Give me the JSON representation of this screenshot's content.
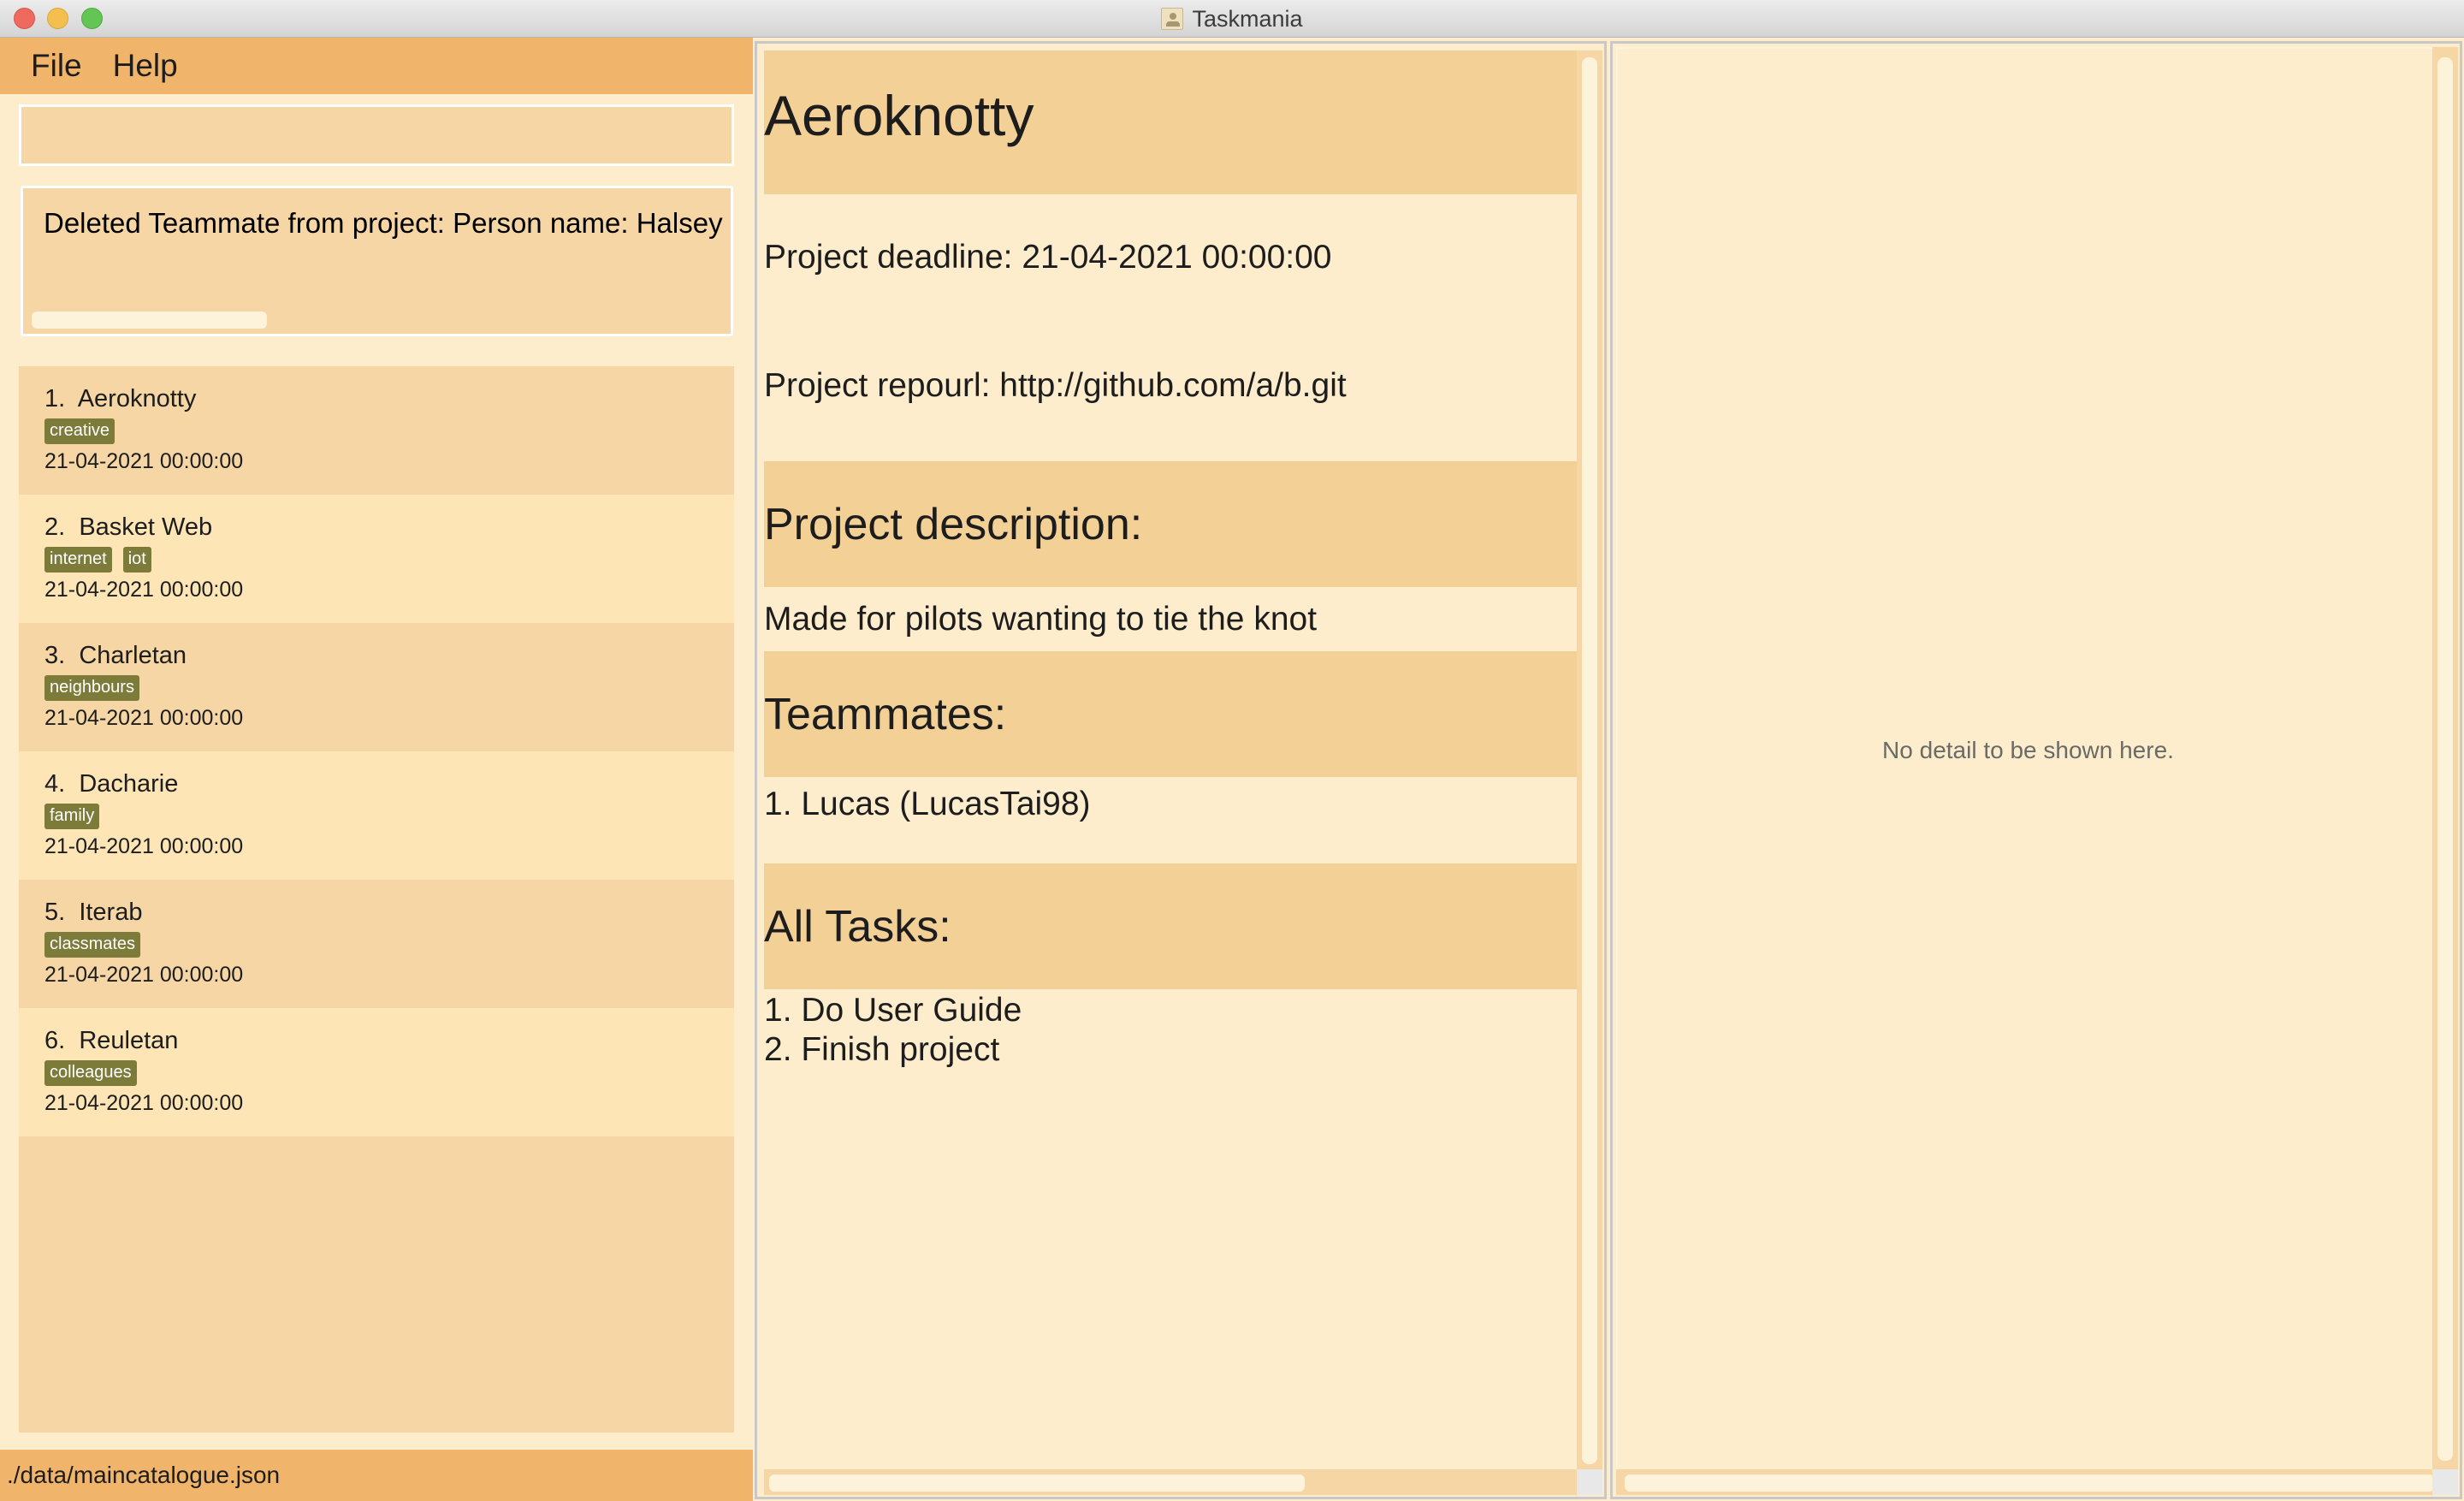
{
  "window": {
    "title": "Taskmania",
    "icon": "app-user-icon"
  },
  "menu": {
    "items": [
      {
        "label": "File"
      },
      {
        "label": "Help"
      }
    ]
  },
  "command_box": {
    "value": "",
    "placeholder": ""
  },
  "result_display": {
    "text": "Deleted Teammate from project:  Person name: Halsey M"
  },
  "project_list": {
    "items": [
      {
        "index": "1.",
        "name": "Aeroknotty",
        "tags": [
          "creative"
        ],
        "deadline": "21-04-2021 00:00:00"
      },
      {
        "index": "2.",
        "name": "Basket Web",
        "tags": [
          "internet",
          "iot"
        ],
        "deadline": "21-04-2021 00:00:00"
      },
      {
        "index": "3.",
        "name": "Charletan",
        "tags": [
          "neighbours"
        ],
        "deadline": "21-04-2021 00:00:00"
      },
      {
        "index": "4.",
        "name": "Dacharie",
        "tags": [
          "family"
        ],
        "deadline": "21-04-2021 00:00:00"
      },
      {
        "index": "5.",
        "name": "Iterab",
        "tags": [
          "classmates"
        ],
        "deadline": "21-04-2021 00:00:00"
      },
      {
        "index": "6.",
        "name": "Reuletan",
        "tags": [
          "colleagues"
        ],
        "deadline": "21-04-2021 00:00:00"
      }
    ]
  },
  "status_bar": {
    "path": "./data/maincatalogue.json"
  },
  "project_detail": {
    "title": "Aeroknotty",
    "deadline": "Project deadline: 21-04-2021 00:00:00",
    "repourl": "Project repourl: http://github.com/a/b.git",
    "description_header": "Project description:",
    "description": "Made for pilots wanting to tie the knot",
    "teammates_header": "Teammates:",
    "teammates": [
      "1. Lucas (LucasTai98)"
    ],
    "tasks_header": "All Tasks:",
    "tasks": [
      "1. Do User Guide",
      "2. Finish project"
    ]
  },
  "detail_panel": {
    "empty_message": "No detail to be shown here."
  },
  "colors": {
    "menu_bar": "#F0B46A",
    "panel_bg": "#FDEDCD",
    "card_dark": "#F5D6A4",
    "card_light": "#FDE5B6",
    "section_header": "#F3D196",
    "tag": "#7C7B3A"
  }
}
